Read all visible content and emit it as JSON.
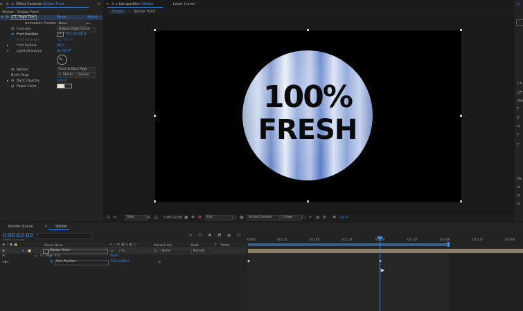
{
  "left_panel": {
    "tab_prefix": "e",
    "tab_label": "Effect Controls",
    "tab_target": "Sticker Front",
    "breadcrumb": "Sticker · Sticker Front",
    "effect_name": "CC Page Turn",
    "reset_label": "Reset",
    "about_label": "About",
    "rows": [
      {
        "label": "Animation Presets",
        "value": "None"
      },
      {
        "label": "Controls",
        "value": "Bottom Right Corne"
      },
      {
        "label": "Fold Position",
        "value": "752.0,528.0"
      },
      {
        "label": "Fold Direction",
        "value": "-0x-49.0°"
      },
      {
        "label": "Fold Radius",
        "value": "30.0"
      },
      {
        "label": "Light Direction",
        "value": "0x-40.0°"
      },
      {
        "label": "Render",
        "value": "Front & Back Page"
      },
      {
        "label": "Back Page",
        "value": "1. Stricki"
      },
      {
        "label": "Back Opacity",
        "value": "100.0"
      },
      {
        "label": "Paper Color",
        "value": ""
      }
    ],
    "back_page_source": "Source"
  },
  "comp_panel": {
    "tab_label": "Composition",
    "tab_target": "Sticker",
    "layer_tab": "Layer (none)",
    "sub_tabs": [
      "Sticker",
      "Sticker Front"
    ],
    "sticker_line1": "100%",
    "sticker_line2": "FRESH",
    "footer": {
      "zoom": "50%",
      "timecode": "0:00:02:00",
      "resolution": "Full",
      "camera": "Active Camera",
      "views": "1 View",
      "exposure": "+0.0"
    }
  },
  "right_panel": {
    "labels": [
      "P",
      "Ch",
      "Pa"
    ],
    "rows": [
      "GT",
      "Bla"
    ]
  },
  "timeline": {
    "tabs": [
      "Render Queue",
      "Sticker"
    ],
    "timecode": "0:00:02:00",
    "timecode_sub": "00050 (25.00 fps)",
    "search_placeholder": "",
    "columns": {
      "source_name": "Source Name",
      "parent": "Parent & Link",
      "mode": "Mode",
      "t": "T",
      "trkmat": "TrkMat"
    },
    "layer": {
      "name": "Sticker Front",
      "parent": "None",
      "mode": "Normal"
    },
    "effect_row": "CC Page Turn",
    "effect_reset": "Reset",
    "property_row": "Fold Position",
    "property_value": "752.0,528.0",
    "ruler_ticks": [
      "0:00f",
      "00:12f",
      "01:00f",
      "01:12f",
      "02:00f",
      "02:12f",
      "03:00f",
      "03:12f",
      "04:00f"
    ]
  },
  "colors": {
    "accent": "#2d8ceb",
    "panel_bg": "#232323",
    "layer_bar": "#8a7f68"
  }
}
